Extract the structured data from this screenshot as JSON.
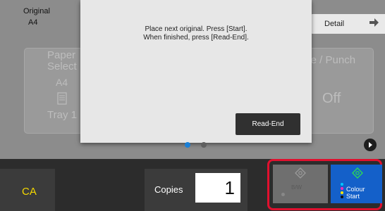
{
  "header": {
    "original_label": "Original",
    "original_size": "A4",
    "detail_label": "Detail"
  },
  "functions": {
    "paper_select_label": "Paper Select",
    "paper_size": "A4",
    "tray_label": "Tray 1",
    "staple_label": "ple / Punch",
    "staple_value": "Off"
  },
  "modal": {
    "line1": "Place next original. Press [Start].",
    "line2": "When finished, press [Read-End].",
    "read_end_label": "Read-End"
  },
  "pager": {
    "page_count": 2,
    "active_page": 1
  },
  "bottom": {
    "ca_label": "CA",
    "copies_label": "Copies",
    "copies_value": "1",
    "bw_start_label": "B/W",
    "colour_start_label_line1": "Colour",
    "colour_start_label_line2": "Start"
  },
  "colors": {
    "ca_text": "#f5d800",
    "accent_blue": "#1460c9",
    "highlight_red": "#e0102e",
    "start_icon_green": "#2bd55a"
  }
}
